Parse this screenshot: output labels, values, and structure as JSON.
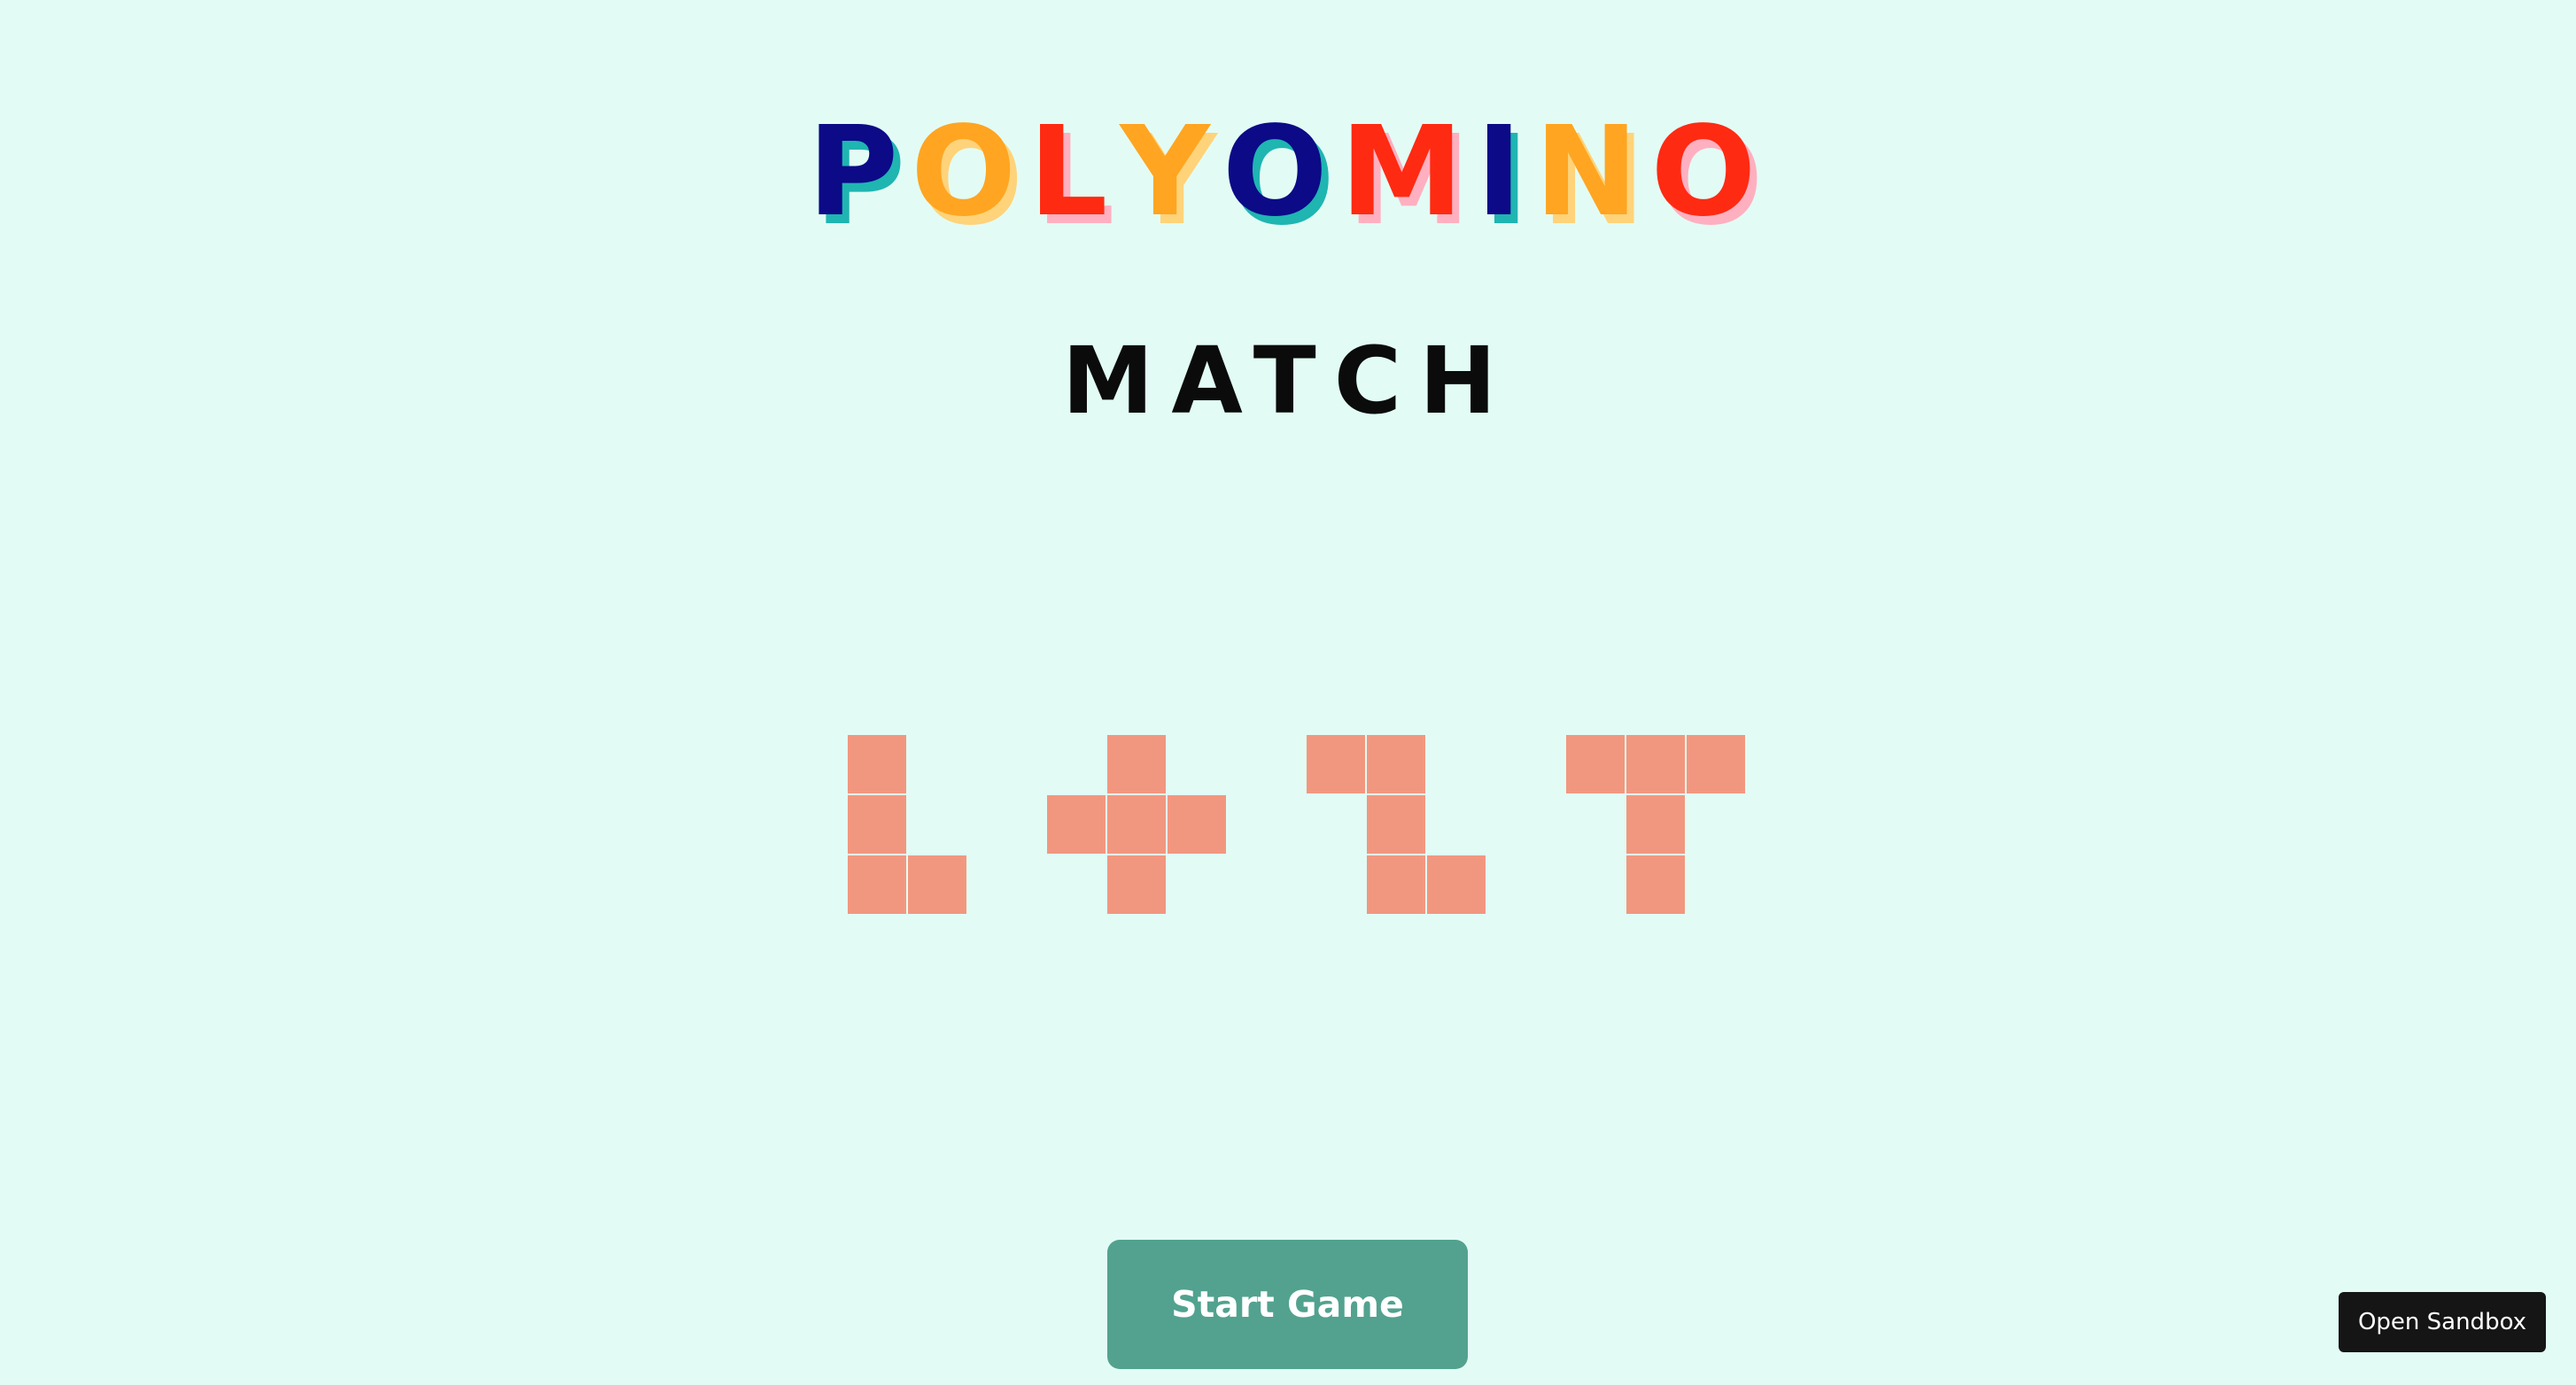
{
  "title": {
    "letters": [
      {
        "char": "P",
        "color": "#0c0a87",
        "shadow": "#1fb5b1"
      },
      {
        "char": "O",
        "color": "#ffa521",
        "shadow": "#ffd37a"
      },
      {
        "char": "L",
        "color": "#ff2a12",
        "shadow": "#ffb0c0"
      },
      {
        "char": "Y",
        "color": "#ffa521",
        "shadow": "#ffd37a"
      },
      {
        "char": "O",
        "color": "#0c0a87",
        "shadow": "#1fb5b1"
      },
      {
        "char": "M",
        "color": "#ff2a12",
        "shadow": "#ffb0c0"
      },
      {
        "char": "I",
        "color": "#0c0a87",
        "shadow": "#1fb5b1"
      },
      {
        "char": "N",
        "color": "#ffa521",
        "shadow": "#ffd37a"
      },
      {
        "char": "O",
        "color": "#ff2a12",
        "shadow": "#ffb0c0"
      }
    ]
  },
  "subtitle": "MATCH",
  "pieces": {
    "color": "#f2977f",
    "shapes": [
      {
        "name": "L",
        "cells": [
          [
            0,
            0
          ],
          [
            0,
            1
          ],
          [
            0,
            2
          ],
          [
            1,
            2
          ]
        ]
      },
      {
        "name": "plus",
        "cells": [
          [
            1,
            0
          ],
          [
            0,
            1
          ],
          [
            1,
            1
          ],
          [
            2,
            1
          ],
          [
            1,
            2
          ]
        ]
      },
      {
        "name": "S",
        "cells": [
          [
            0,
            0
          ],
          [
            1,
            0
          ],
          [
            1,
            1
          ],
          [
            1,
            2
          ],
          [
            2,
            2
          ]
        ]
      },
      {
        "name": "T",
        "cells": [
          [
            0,
            0
          ],
          [
            1,
            0
          ],
          [
            2,
            0
          ],
          [
            1,
            1
          ],
          [
            1,
            2
          ]
        ]
      }
    ]
  },
  "buttons": {
    "start": "Start Game",
    "sandbox": "Open Sandbox"
  }
}
